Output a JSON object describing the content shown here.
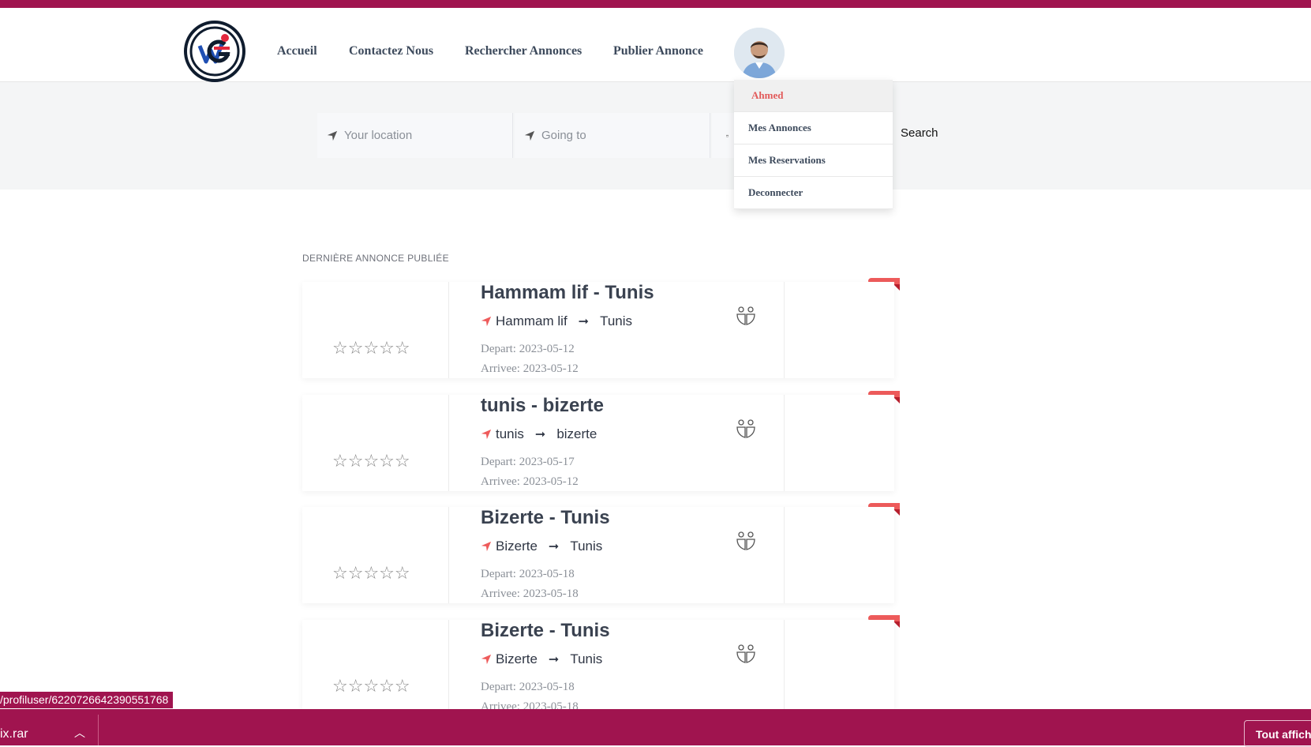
{
  "nav": {
    "items": [
      "Accueil",
      "Contactez Nous",
      "Rechercher Annonces",
      "Publier Annonce"
    ]
  },
  "search": {
    "from_placeholder": "Your location",
    "to_placeholder": "Going to",
    "button": "Search"
  },
  "user_menu": {
    "username": "Ahmed",
    "items": [
      "Mes Annonces",
      "Mes Reservations",
      "Deconnecter"
    ]
  },
  "section_title": "DERNIÈRE ANNONCE PUBLIÉE",
  "cards": [
    {
      "title": "Hammam lif - Tunis",
      "from": "Hammam lif",
      "to": "Tunis",
      "depart": "Depart: 2023-05-12",
      "arrivee": "Arrivee: 2023-05-12",
      "rating": 0
    },
    {
      "title": "tunis - bizerte",
      "from": "tunis",
      "to": "bizerte",
      "depart": "Depart: 2023-05-17",
      "arrivee": "Arrivee: 2023-05-12",
      "rating": 0
    },
    {
      "title": "Bizerte - Tunis",
      "from": "Bizerte",
      "to": "Tunis",
      "depart": "Depart: 2023-05-18",
      "arrivee": "Arrivee: 2023-05-18",
      "rating": 0
    },
    {
      "title": "Bizerte - Tunis",
      "from": "Bizerte",
      "to": "Tunis",
      "depart": "Depart: 2023-05-18",
      "arrivee": "Arrivee: 2023-05-18",
      "rating": 0
    }
  ],
  "status_url": "/profiluser/6220726642390551768",
  "download_bar": {
    "file": "ix.rar",
    "show_all": "Tout affich"
  },
  "colors": {
    "brand": "#a0144f",
    "accent": "#ee5b5b",
    "text": "#3d4a5c"
  },
  "icons": [
    "logo",
    "location-arrow-icon",
    "calendar-icon",
    "star-icon",
    "seat-icon",
    "chevron-up-icon"
  ]
}
